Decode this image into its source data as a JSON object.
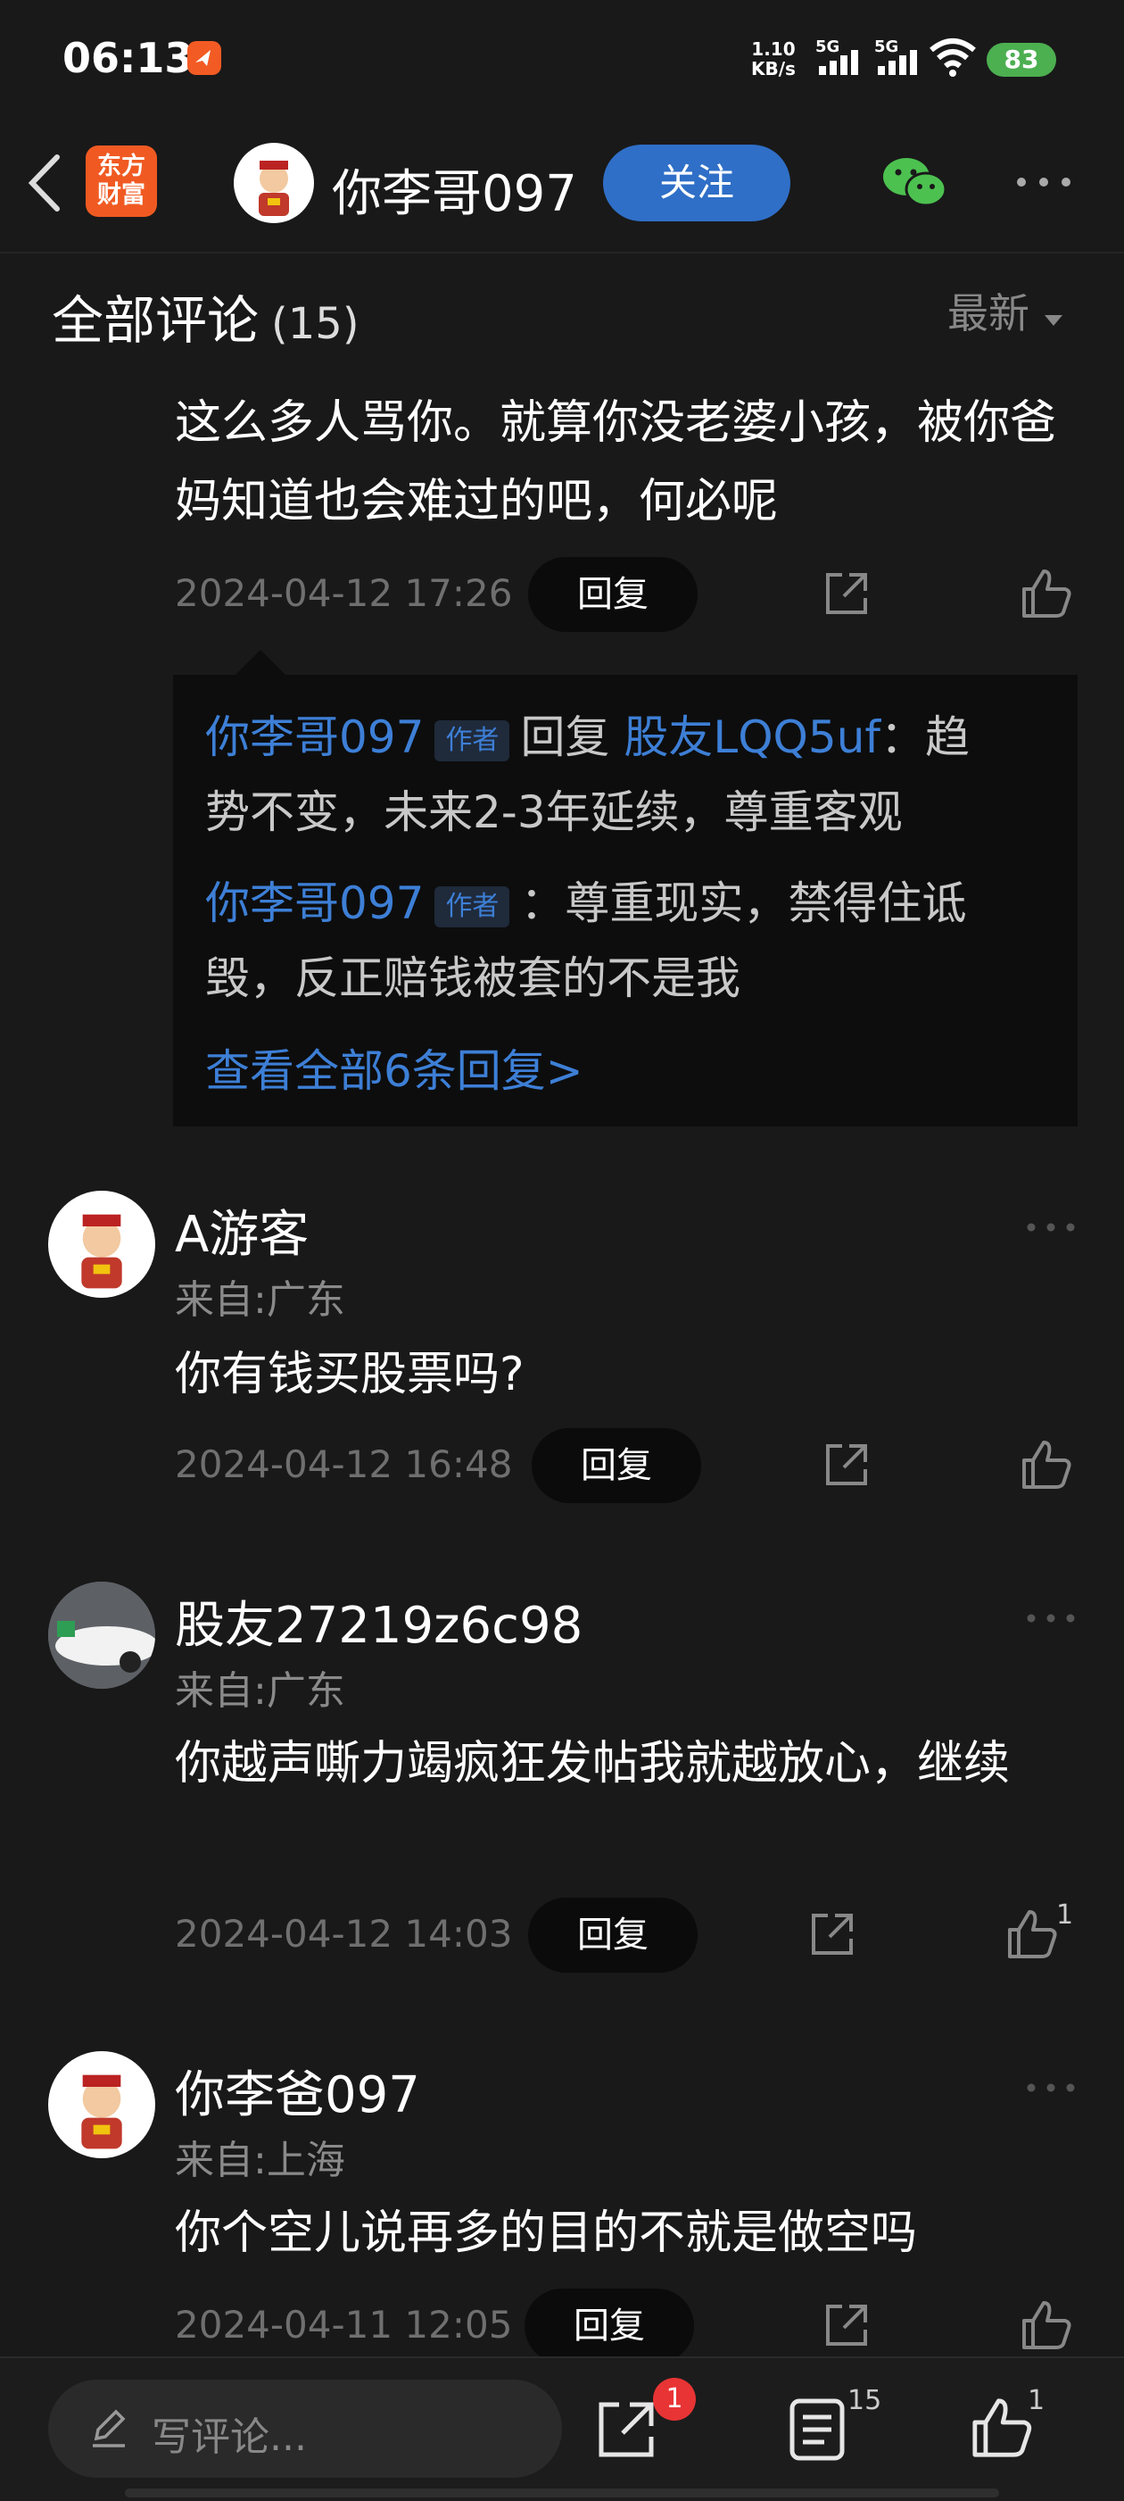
{
  "status_bar": {
    "time": "06:13",
    "net_speed_value": "1.10",
    "net_speed_unit": "KB/s",
    "sim1": "5G",
    "sim2": "5G",
    "battery": "83"
  },
  "header": {
    "app_logo_line1": "东方",
    "app_logo_line2": "财富",
    "author_name": "你李哥097",
    "follow_label": "关注"
  },
  "section": {
    "title": "全部评论",
    "count": "(15)",
    "sort_label": "最新"
  },
  "comments": [
    {
      "text": "这么多人骂你。就算你没老婆小孩，被你爸妈知道也会难过的吧，何必呢",
      "time": "2024-04-12 17:26",
      "reply_label": "回复"
    },
    {
      "name": "A游客",
      "location": "来自:广东",
      "text": "你有钱买股票吗?",
      "time": "2024-04-12 16:48",
      "reply_label": "回复"
    },
    {
      "name": "股友27219z6c98",
      "location": "来自:广东",
      "text": "你越声嘶力竭疯狂发帖我就越放心，继续",
      "time": "2024-04-12 14:03",
      "reply_label": "回复",
      "likes": "1"
    },
    {
      "name": "你李爸097",
      "location": "来自:上海",
      "text": "你个空儿说再多的目的不就是做空吗",
      "time": "2024-04-11 12:05",
      "reply_label": "回复"
    }
  ],
  "replies": {
    "r1_author": "你李哥097",
    "r1_tag": "作者",
    "r1_verb": "回复",
    "r1_target": "股友LQQ5uf",
    "r1_text_a": "：趋",
    "r1_text_b": "势不变，未来2-3年延续，尊重客观",
    "r2_author": "你李哥097",
    "r2_tag": "作者",
    "r2_text_a": "：尊重现实，禁得住诋",
    "r2_text_b": "毁，反正赔钱被套的不是我",
    "view_all": "查看全部6条回复>"
  },
  "bottom_bar": {
    "placeholder": "写评论...",
    "share_badge": "1",
    "comments_count": "15",
    "likes_count": "1"
  },
  "colors": {
    "background": "#191919",
    "accent_blue": "#3d7fd6",
    "follow_button": "#2f6fc7",
    "badge_red": "#e83434",
    "battery_green": "#4caf50"
  }
}
